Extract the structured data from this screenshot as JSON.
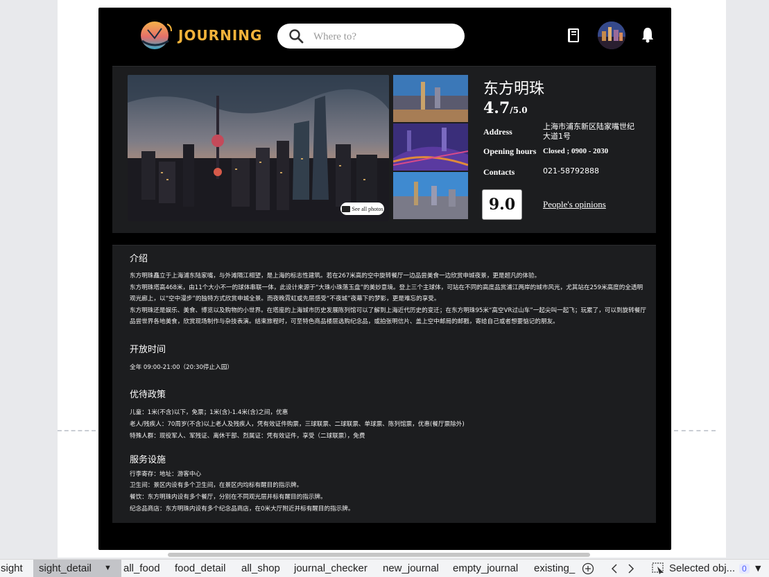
{
  "header": {
    "logo_text": "JOURNING",
    "search_placeholder": "Where to?"
  },
  "place": {
    "title": "东方明珠",
    "rating_value": "4.7",
    "rating_suffix": "/5.0",
    "address_label": "Address",
    "address_value": "上海市浦东新区陆家嘴世纪大道1号",
    "hours_label": "Opening hours",
    "hours_value": "Closed ; 0900 - 2030",
    "contacts_label": "Contacts",
    "contacts_value": "021-58792888",
    "score": "9.0",
    "opinions_link": "People's opinions",
    "see_all_photos": "See all photos"
  },
  "description": {
    "intro_title": "介绍",
    "intro_lines": [
      "东方明珠矗立于上海浦东陆家嘴，与外滩隔江相望，是上海的标志性建筑。若在267米高的空中旋转餐厅一边品尝美食一边欣赏申城夜景，更是超凡的体验。",
      "东方明珠塔高468米，由11个大小不一的球体串联一体，此设计来源于“大珠小珠落玉盘”的美妙意境。登上三个主球体，可站在不同的高度品赏浦江两岸的城市风光，尤其站在259米高度的全透明观光廊上，以“空中漫步”的独特方式欣赏申城全景。而夜晚霓虹或先层感受“不夜城”夜幕下的梦影，更是难忘的享受。",
      "东方明珠还是娱乐、美食、博览以及购物的小世界。在塔座的上海城市历史发展陈列馆可以了解到上海近代历史的变迁；在东方明珠95米“高空VR过山车”一起尖叫一起飞；玩累了，可以到旋转餐厅品尝世界各地美食，欣赏现场制作与杂技表演。结束旅程时，可至特色商品楼层选购纪念品，或拍张明信片、盖上空中邮局的邮戳，寄给自己或者想要惦记的朋友。"
    ],
    "hours_title": "开放时间",
    "hours_text": "全年 09:00-21:00（20:30停止入园）",
    "policy_title": "优待政策",
    "policy_lines": [
      "儿童：1米(不含)以下，免票；1米(含)-1.4米(含)之间，优惠",
      "老人/残疾人：70周岁(不含)以上老人及残疾人，凭有效证件购票，三球联票、二球联票、单球票、陈列馆票，优惠(餐厅票除外)",
      "特殊人群：现役军人、军残证、离休干部、烈属证：凭有效证件，享受（二球联票），免费"
    ],
    "services_title": "服务设施",
    "services_lines": [
      "行李寄存：地址：游客中心",
      "卫生间：景区内设有多个卫生间，在景区内均标有醒目的指示牌。",
      "餐饮：东方明珠内设有多个餐厅，分别在不同观光层并标有醒目的指示牌。",
      "纪念品商店：东方明珠内设有多个纪念品商店，在0米大厅附近并标有醒目的指示牌。"
    ]
  },
  "tabs": [
    "sight",
    "sight_detail",
    "all_food",
    "food_detail",
    "all_shop",
    "journal_checker",
    "new_journal",
    "empty_journal",
    "existing_"
  ],
  "active_tab": "sight_detail",
  "statusbar": {
    "selected_label": "Selected obj...",
    "selected_count": "0"
  },
  "colors": {
    "frame": "#000000",
    "panel": "#1c1d1f",
    "logo_accent": "#f3b23a",
    "count_badge": "#4a5cff"
  }
}
